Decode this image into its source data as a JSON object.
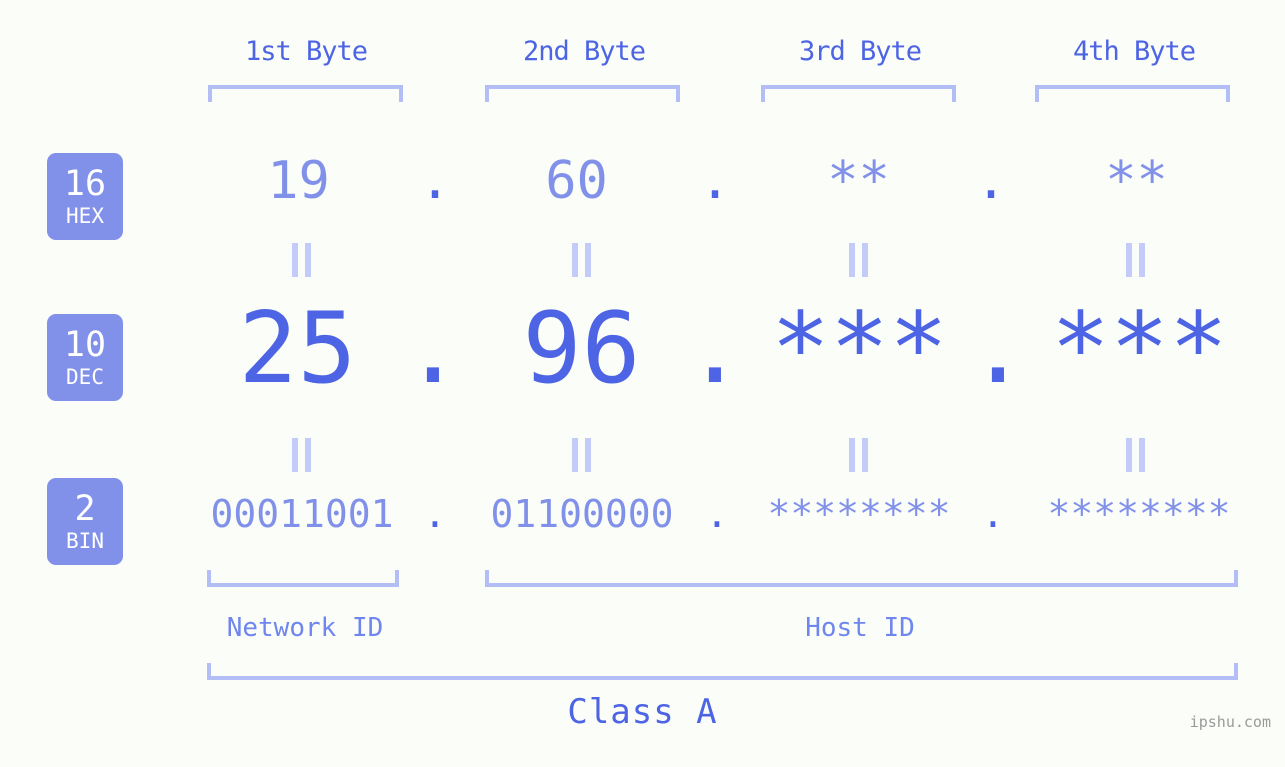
{
  "watermark": "ipshu.com",
  "class_label": "Class A",
  "colors": {
    "background": "#fbfdf8",
    "accent_strong": "#4d64e4",
    "accent_light": "#8191ea",
    "bracket": "#b3bdf6",
    "badge_bg": "#8191ea",
    "badge_text": "#ffffff",
    "eqbar": "#c3cbf8",
    "watermark_text": "#9a9a9a"
  },
  "byte_headers": [
    {
      "label": "1st Byte"
    },
    {
      "label": "2nd Byte"
    },
    {
      "label": "3rd Byte"
    },
    {
      "label": "4th Byte"
    }
  ],
  "radix_badges": [
    {
      "num": "16",
      "name": "HEX"
    },
    {
      "num": "10",
      "name": "DEC"
    },
    {
      "num": "2",
      "name": "BIN"
    }
  ],
  "rows": {
    "hex": {
      "values": [
        "19",
        "60",
        "**",
        "**"
      ],
      "separator": "."
    },
    "dec": {
      "values": [
        "25",
        "96",
        "***",
        "***"
      ],
      "separator": "."
    },
    "bin": {
      "values": [
        "00011001",
        "01100000",
        "********",
        "********"
      ],
      "separator": "."
    }
  },
  "equals_marks": {
    "glyph": "=",
    "count_per_row": 4,
    "rows": 2
  },
  "id_labels": [
    {
      "label": "Network ID"
    },
    {
      "label": "Host ID"
    }
  ]
}
